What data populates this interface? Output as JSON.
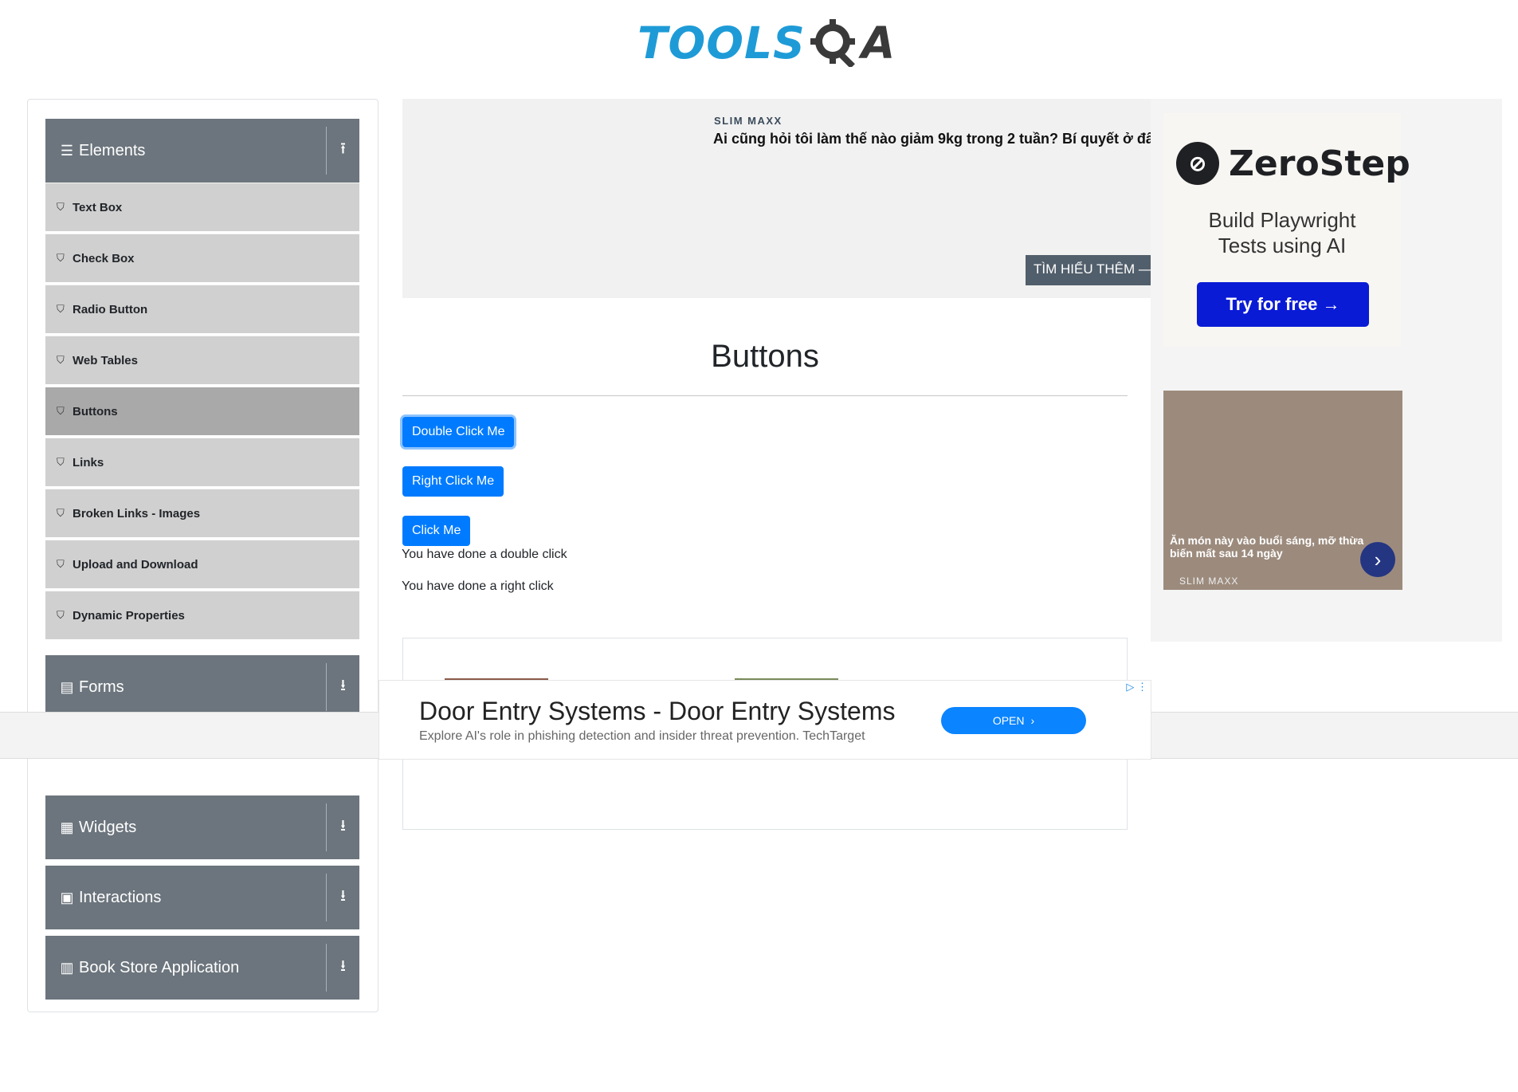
{
  "header": {
    "logo_tools": "TOOLS",
    "logo_qa": "A"
  },
  "sidebar": {
    "groups": [
      {
        "label": "Elements",
        "icon": "hamburger-icon",
        "state": "expanded"
      },
      {
        "label": "Forms",
        "icon": "form-icon",
        "state": "collapsed"
      },
      {
        "label": "Widgets",
        "icon": "widgets-icon",
        "state": "collapsed"
      },
      {
        "label": "Interactions",
        "icon": "interactions-icon",
        "state": "collapsed"
      },
      {
        "label": "Book Store Application",
        "icon": "bookstore-icon",
        "state": "collapsed"
      }
    ],
    "items": [
      {
        "label": "Text Box"
      },
      {
        "label": "Check Box"
      },
      {
        "label": "Radio Button"
      },
      {
        "label": "Web Tables"
      },
      {
        "label": "Buttons",
        "active": true
      },
      {
        "label": "Links"
      },
      {
        "label": "Broken Links - Images"
      },
      {
        "label": "Upload and Download"
      },
      {
        "label": "Dynamic Properties"
      }
    ]
  },
  "top_ad": {
    "brand": "SLIM MAXX",
    "headline": "Ai cũng hỏi tôi làm thế nào giảm 9kg trong 2 tuần? Bí quyết ở đâ",
    "cta": "TÌM HIỂU THÊM —"
  },
  "main": {
    "title": "Buttons",
    "double_click_label": "Double Click Me",
    "right_click_label": "Right Click Me",
    "click_label": "Click Me",
    "double_click_message": "You have done a double click",
    "right_click_message": "You have done a right click"
  },
  "right_ad": {
    "zerostep": {
      "name": "ZeroStep",
      "tagline_1": "Build Playwright",
      "tagline_2": "Tests using AI",
      "cta": "Try for free →"
    },
    "slim": {
      "text": "Ăn món này vào buổi sáng, mỡ thừa biến mất sau 14 ngày",
      "brand": "SLIM MAXX"
    }
  },
  "banner": {
    "headline": "Door Entry Systems - Door Entry Systems",
    "sub": "Explore AI's role in phishing detection and insider threat prevention. TechTarget",
    "open": "OPEN"
  },
  "colors": {
    "primary": "#007bff",
    "sidebar_group": "#6c757d",
    "sidebar_item": "#d0d0d0",
    "sidebar_active": "#a9a9a9",
    "logo_blue": "#1e9bd7"
  }
}
